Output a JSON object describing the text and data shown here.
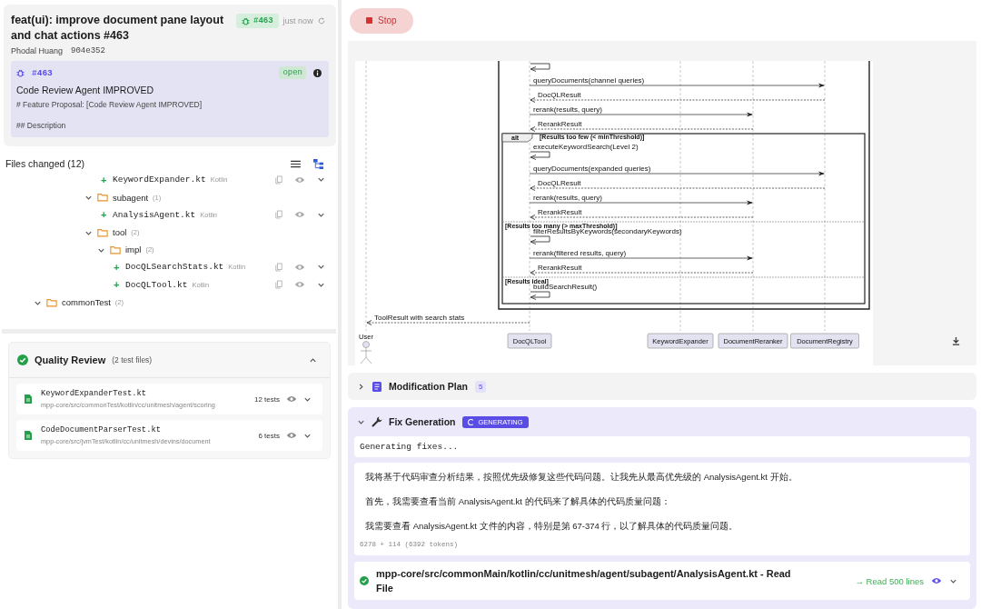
{
  "pull_request": {
    "title": "feat(ui): improve document pane layout and chat actions #463",
    "badge": "#463",
    "time": "just now",
    "author": "Phodal Huang",
    "commit": "904e352",
    "issue": {
      "number": "#463",
      "state": "open",
      "title": "Code Review Agent IMPROVED",
      "lines": [
        "# Feature Proposal: [Code Review Agent IMPROVED]",
        "## Description"
      ]
    }
  },
  "files_changed": {
    "title": "Files changed (12)",
    "view_modes": [
      {
        "kind": "list",
        "selected": false
      },
      {
        "kind": "tree",
        "selected": true
      }
    ],
    "tree": [
      {
        "children": [
          {
            "children": [
              {
                "children": [
                  {
                    "children": [
                      {
                        "children": [
                          {
                            "kind": "file",
                            "change": "+",
                            "name": "KeywordExpander.kt",
                            "language": "Kotlin"
                          }
                        ]
                      },
                      {
                        "kind": "folder",
                        "name": "subagent",
                        "count": "(1)",
                        "expanded": true,
                        "children": [
                          {
                            "kind": "file",
                            "change": "+",
                            "name": "AnalysisAgent.kt",
                            "language": "Kotlin"
                          }
                        ]
                      },
                      {
                        "kind": "folder",
                        "name": "tool",
                        "count": "(2)",
                        "expanded": true,
                        "children": [
                          {
                            "kind": "folder",
                            "name": "impl",
                            "count": "(2)",
                            "expanded": true,
                            "children": [
                              {
                                "kind": "file",
                                "change": "+",
                                "name": "DocQLSearchStats.kt",
                                "language": "Kotlin"
                              },
                              {
                                "kind": "file",
                                "change": "+",
                                "name": "DocQLTool.kt",
                                "language": "Kotlin"
                              }
                            ]
                          }
                        ]
                      }
                    ]
                  }
                ]
              }
            ]
          }
        ]
      },
      {
        "kind": "folder",
        "name": "commonTest",
        "count": "(2)",
        "expanded": true
      }
    ]
  },
  "quality_review": {
    "title": "Quality Review",
    "subtitle": "(2 test files)",
    "passed": true,
    "expanded": true,
    "files": [
      {
        "name": "KeywordExpanderTest.kt",
        "path": "mpp-core/src/commonTest/kotlin/cc/unitmesh/agent/scoring",
        "tests": "12 tests"
      },
      {
        "name": "CodeDocumentParserTest.kt",
        "path": "mpp-core/src/jvmTest/kotlin/cc/unitmesh/devins/document",
        "tests": "6 tests"
      }
    ]
  },
  "stop_button": {
    "label": "Stop"
  },
  "diagram": {
    "participants": [
      {
        "name": "User",
        "kind": "actor"
      },
      {
        "name": "DocQLTool",
        "kind": "box"
      },
      {
        "name": "KeywordExpander",
        "kind": "box"
      },
      {
        "name": "DocumentReranker",
        "kind": "box"
      },
      {
        "name": "DocumentRegistry",
        "kind": "box"
      }
    ],
    "steps": [
      {
        "kind": "group",
        "steps": [
          {
            "kind": "self"
          },
          {
            "kind": "call-registry",
            "label": "queryDocuments(channel queries)"
          },
          {
            "kind": "return-registry",
            "label": "DocQLResult"
          },
          {
            "kind": "call-reranker",
            "label": "rerank(results, query)"
          },
          {
            "kind": "return-reranker",
            "label": "RerankResult"
          },
          {
            "kind": "alt",
            "label": "alt",
            "operands": [
              {
                "guard": "[Results too few (< minThreshold)]",
                "steps": [
                  {
                    "kind": "self",
                    "label": "executeKeywordSearch(Level 2)"
                  },
                  {
                    "kind": "call-registry",
                    "label": "queryDocuments(expanded queries)"
                  },
                  {
                    "kind": "return-registry",
                    "label": "DocQLResult"
                  },
                  {
                    "kind": "call-reranker",
                    "label": "rerank(results, query)"
                  },
                  {
                    "kind": "return-reranker",
                    "label": "RerankResult"
                  }
                ]
              },
              {
                "guard": "[Results too many (> maxThreshold)]",
                "steps": [
                  {
                    "kind": "self",
                    "label": "filterResultsByKeywords(secondaryKeywords)"
                  },
                  {
                    "kind": "call-reranker",
                    "label": "rerank(filtered results, query)"
                  },
                  {
                    "kind": "return-reranker",
                    "label": "RerankResult"
                  }
                ]
              },
              {
                "guard": "[Results ideal]",
                "steps": [
                  {
                    "kind": "self",
                    "label": "buildSearchResult()"
                  }
                ]
              }
            ]
          }
        ]
      },
      {
        "kind": "return-user",
        "label": "ToolResult with search stats"
      }
    ]
  },
  "modification_plan": {
    "title": "Modification Plan",
    "count": "5",
    "expanded": false
  },
  "fix_generation": {
    "title": "Fix Generation",
    "status": "GENERATING",
    "expanded": true,
    "output": "Generating fixes...",
    "message": {
      "paragraphs": [
        "我将基于代码审查分析结果，按照优先级修复这些代码问题。让我先从最高优先级的 AnalysisAgent.kt 开始。",
        "首先，我需要查看当前 AnalysisAgent.kt 的代码来了解具体的代码质量问题：",
        "我需要查看 AnalysisAgent.kt 文件的内容，特别是第 67-374 行，以了解具体的代码质量问题。"
      ],
      "tokens": "6278 + 114 (6392 tokens)"
    },
    "tool_call": {
      "title": "mpp-core/src/commonMain/kotlin/cc/unitmesh/agent/subagent/AnalysisAgent.kt - Read File",
      "result": "→ Read 500 lines",
      "success": true
    }
  }
}
